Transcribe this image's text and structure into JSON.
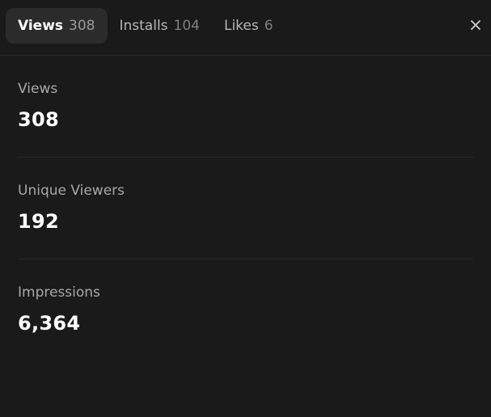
{
  "tabs": [
    {
      "label": "Views",
      "count": "308"
    },
    {
      "label": "Installs",
      "count": "104"
    },
    {
      "label": "Likes",
      "count": "6"
    }
  ],
  "active_tab": "Views",
  "close_icon": "close-icon",
  "stats": [
    {
      "label": "Views",
      "value": "308"
    },
    {
      "label": "Unique Viewers",
      "value": "192"
    },
    {
      "label": "Impressions",
      "value": "6,364"
    }
  ],
  "colors": {
    "background": "#1a1a1a",
    "active_tab_bg": "#2b2b2b",
    "divider": "#2a2a2a",
    "label": "#a8a8a8",
    "value": "#ffffff"
  }
}
